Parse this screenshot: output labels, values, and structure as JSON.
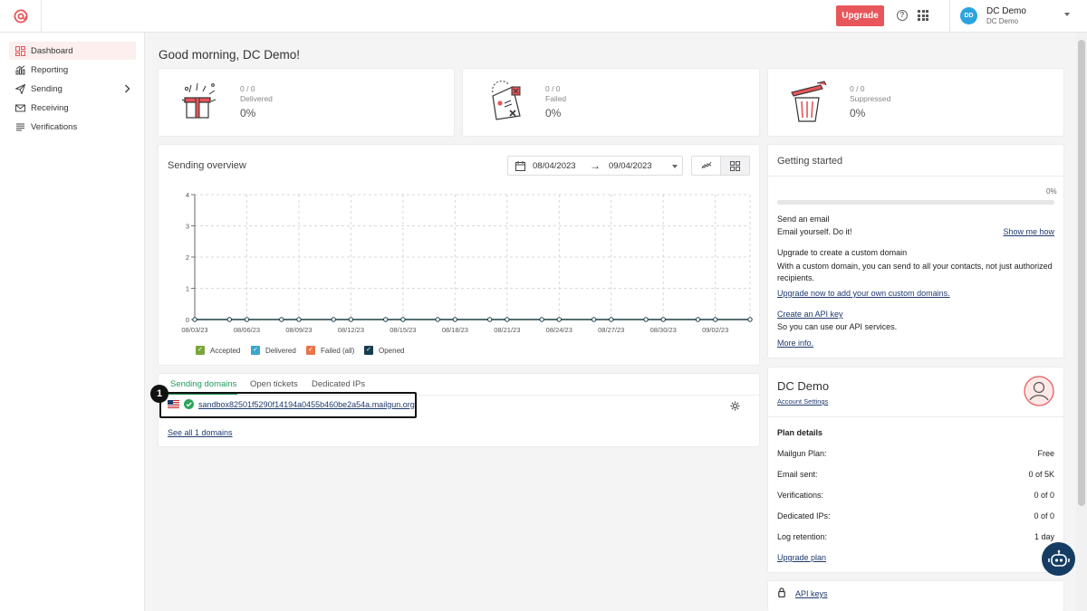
{
  "header": {
    "upgrade_label": "Upgrade",
    "help_glyph": "?",
    "user_initials": "DD",
    "user_name": "DC Demo",
    "user_subtitle": "DC Demo"
  },
  "sidebar": {
    "items": [
      {
        "label": "Dashboard",
        "icon": "dashboard-icon"
      },
      {
        "label": "Reporting",
        "icon": "reporting-icon"
      },
      {
        "label": "Sending",
        "icon": "send-icon"
      },
      {
        "label": "Receiving",
        "icon": "mail-icon"
      },
      {
        "label": "Verifications",
        "icon": "list-icon"
      }
    ]
  },
  "greeting": "Good morning, DC Demo!",
  "stats": [
    {
      "fraction": "0 / 0",
      "label": "Delivered",
      "percent": "0%"
    },
    {
      "fraction": "0 / 0",
      "label": "Failed",
      "percent": "0%"
    },
    {
      "fraction": "0 / 0",
      "label": "Suppressed",
      "percent": "0%"
    }
  ],
  "overview": {
    "title": "Sending overview",
    "date_from": "08/04/2023",
    "date_to": "09/04/2023",
    "chart_data": {
      "type": "line",
      "x": [
        "08/03/23",
        "08/04/23",
        "08/05/23",
        "08/06/23",
        "08/07/23",
        "08/08/23",
        "08/09/23",
        "08/10/23",
        "08/11/23",
        "08/12/23",
        "08/13/23",
        "08/14/23",
        "08/15/23",
        "08/16/23",
        "08/17/23",
        "08/18/23",
        "08/19/23",
        "08/20/23",
        "08/21/23",
        "08/22/23",
        "08/23/23",
        "08/24/23",
        "08/25/23",
        "08/26/23",
        "08/27/23",
        "08/28/23",
        "08/29/23",
        "08/30/23",
        "08/31/23",
        "09/01/23",
        "09/02/23",
        "09/03/23",
        "09/04/23"
      ],
      "x_ticks": [
        "08/03/23",
        "08/06/23",
        "08/09/23",
        "08/12/23",
        "08/15/23",
        "08/18/23",
        "08/21/23",
        "08/24/23",
        "08/27/23",
        "08/30/23",
        "09/02/23"
      ],
      "y_ticks": [
        0,
        1,
        2,
        3,
        4
      ],
      "ylim": [
        0,
        4
      ],
      "series": [
        {
          "name": "Accepted",
          "color": "#7aa63a",
          "values": [
            0,
            0,
            0,
            0,
            0,
            0,
            0,
            0,
            0,
            0,
            0,
            0,
            0,
            0,
            0,
            0,
            0,
            0,
            0,
            0,
            0,
            0,
            0,
            0,
            0,
            0,
            0,
            0,
            0,
            0,
            0,
            0,
            0
          ]
        },
        {
          "name": "Delivered",
          "color": "#3aa6cf",
          "values": [
            0,
            0,
            0,
            0,
            0,
            0,
            0,
            0,
            0,
            0,
            0,
            0,
            0,
            0,
            0,
            0,
            0,
            0,
            0,
            0,
            0,
            0,
            0,
            0,
            0,
            0,
            0,
            0,
            0,
            0,
            0,
            0,
            0
          ]
        },
        {
          "name": "Failed (all)",
          "color": "#e8744a",
          "values": [
            0,
            0,
            0,
            0,
            0,
            0,
            0,
            0,
            0,
            0,
            0,
            0,
            0,
            0,
            0,
            0,
            0,
            0,
            0,
            0,
            0,
            0,
            0,
            0,
            0,
            0,
            0,
            0,
            0,
            0,
            0,
            0,
            0
          ]
        },
        {
          "name": "Opened",
          "color": "#153d4f",
          "values": [
            0,
            0,
            0,
            0,
            0,
            0,
            0,
            0,
            0,
            0,
            0,
            0,
            0,
            0,
            0,
            0,
            0,
            0,
            0,
            0,
            0,
            0,
            0,
            0,
            0,
            0,
            0,
            0,
            0,
            0,
            0,
            0,
            0
          ]
        }
      ],
      "grid": true,
      "legend": "bottom"
    }
  },
  "domains": {
    "tabs": [
      "Sending domains",
      "Open tickets",
      "Dedicated IPs"
    ],
    "domain": "sandbox82501f5290f14194a0455b460be2a54a.mailgun.org",
    "see_all": "See all 1 domains",
    "step_number": "1"
  },
  "getting_started": {
    "title": "Getting started",
    "progress": 0,
    "progress_label": "0%",
    "items": [
      {
        "title": "Send an email",
        "desc": "Email yourself. Do it!",
        "link": "Show me how"
      },
      {
        "title": "Upgrade to create a custom domain",
        "desc": "With a custom domain, you can send to all your contacts, not just authorized recipients.",
        "link": "Upgrade now to add your own custom domains."
      },
      {
        "title": "Create an API key",
        "desc": "So you can use our API services.",
        "link": "More info."
      }
    ]
  },
  "account": {
    "name": "DC Demo",
    "settings_link": "Account Settings",
    "plan_title": "Plan details",
    "rows": [
      {
        "label": "Mailgun Plan:",
        "value": "Free"
      },
      {
        "label": "Email sent:",
        "value": "0 of 5K"
      },
      {
        "label": "Verifications:",
        "value": "0 of 0"
      },
      {
        "label": "Dedicated IPs:",
        "value": "0 of 0"
      },
      {
        "label": "Log retention:",
        "value": "1 day"
      }
    ],
    "upgrade_link": "Upgrade plan"
  },
  "api_keys_link": "API keys",
  "colors": {
    "accent": "#e8555a",
    "active_bg": "#fcefee",
    "tab_active": "#1f9e5a",
    "link": "#1f3a6e"
  }
}
